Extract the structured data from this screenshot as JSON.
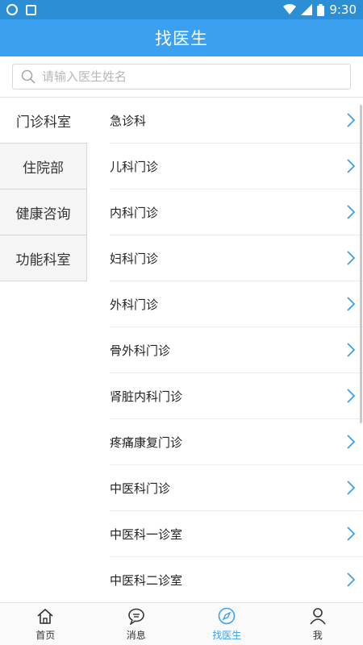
{
  "status_bar": {
    "time": "9:30"
  },
  "header": {
    "title": "找医生"
  },
  "search": {
    "placeholder": "请输入医生姓名"
  },
  "categories": [
    {
      "label": "门诊科室",
      "selected": true
    },
    {
      "label": "住院部",
      "selected": false
    },
    {
      "label": "健康咨询",
      "selected": false
    },
    {
      "label": "功能科室",
      "selected": false
    }
  ],
  "departments": [
    "急诊科",
    "儿科门诊",
    "内科门诊",
    "妇科门诊",
    "外科门诊",
    "骨外科门诊",
    "肾脏内科门诊",
    "疼痛康复门诊",
    "中医科门诊",
    "中医科一诊室",
    "中医科二诊室"
  ],
  "tabs": [
    {
      "label": "首页",
      "active": false
    },
    {
      "label": "消息",
      "active": false
    },
    {
      "label": "找医生",
      "active": true
    },
    {
      "label": "我",
      "active": false
    }
  ],
  "colors": {
    "accent": "#3aa0ef",
    "status_bar": "#2c8fd6"
  }
}
